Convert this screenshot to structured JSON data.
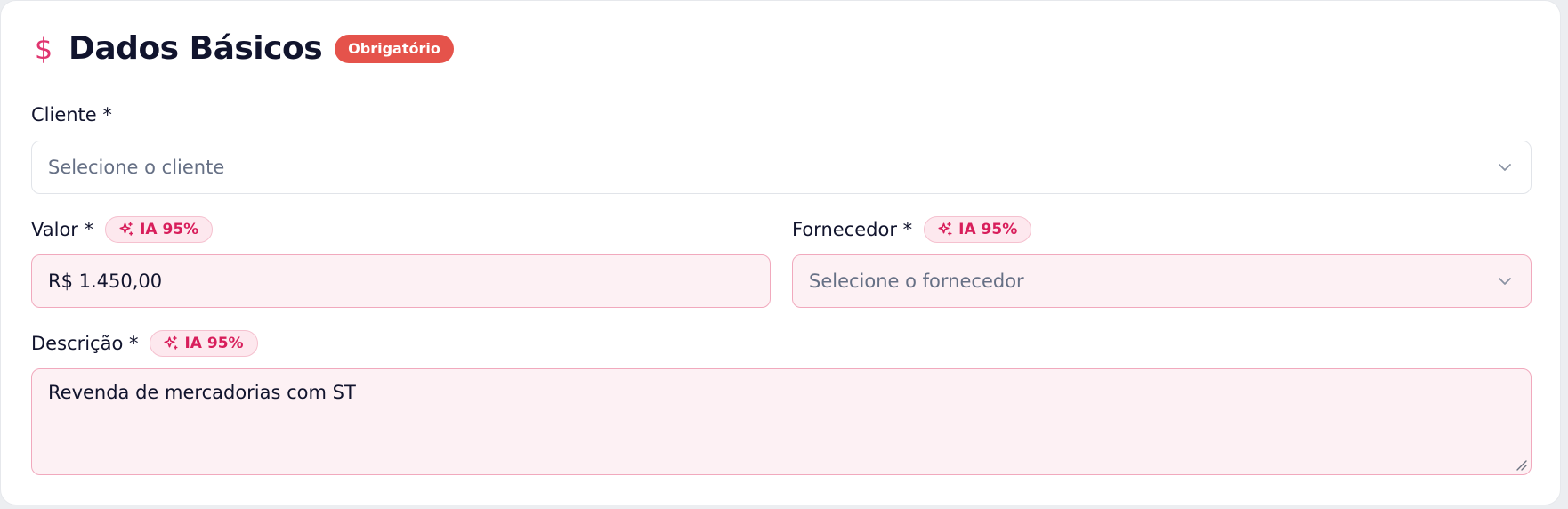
{
  "section": {
    "icon": "dollar-icon",
    "glyph": "$",
    "title": "Dados Básicos",
    "required_badge": "Obrigatório"
  },
  "fields": {
    "cliente": {
      "label": "Cliente *",
      "placeholder": "Selecione o cliente"
    },
    "valor": {
      "label": "Valor *",
      "ai_badge": "IA 95%",
      "value": "R$ 1.450,00"
    },
    "fornecedor": {
      "label": "Fornecedor *",
      "ai_badge": "IA 95%",
      "placeholder": "Selecione o fornecedor"
    },
    "descricao": {
      "label": "Descrição *",
      "ai_badge": "IA 95%",
      "value": "Revenda de mercadorias com ST"
    }
  },
  "colors": {
    "accent": "#e0356f",
    "required_badge": "#e5534b",
    "ai_fill": "#fdf1f4",
    "ai_border": "#f1a9bd",
    "ai_text": "#d81e5b"
  }
}
